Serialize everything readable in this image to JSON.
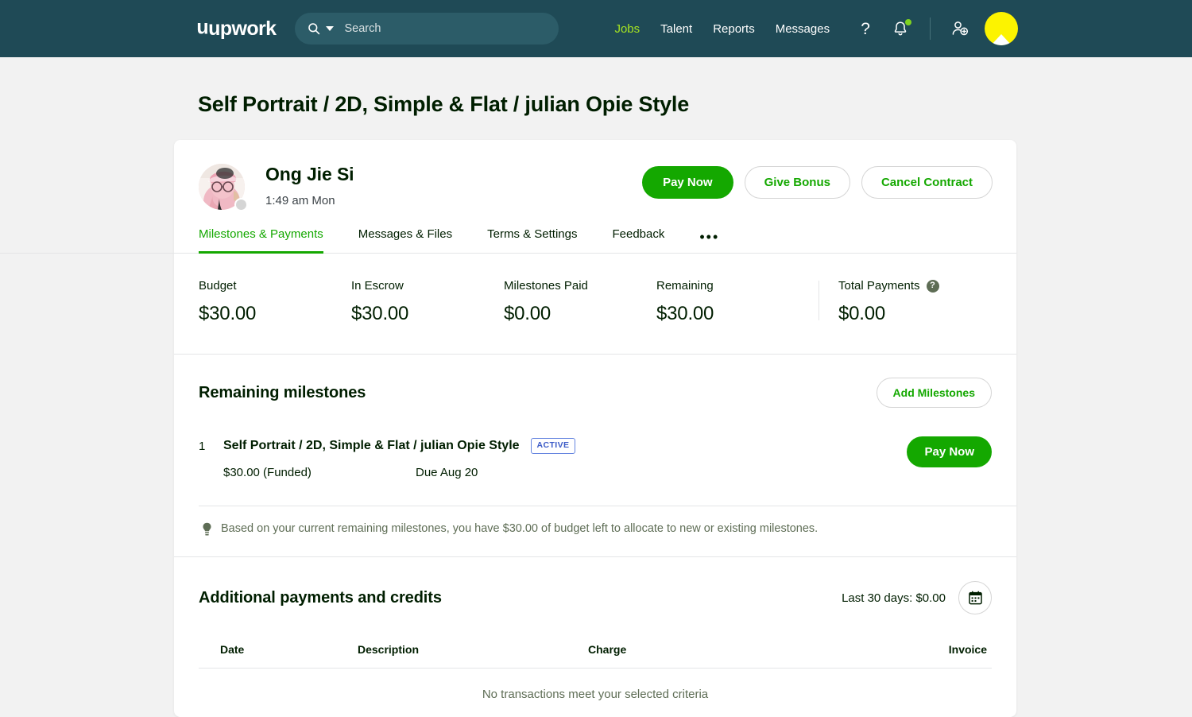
{
  "topnav": {
    "logo": "upwork",
    "search_placeholder": "Search",
    "search_value": "",
    "links": [
      {
        "label": "Jobs",
        "active": true
      },
      {
        "label": "Talent",
        "active": false
      },
      {
        "label": "Reports",
        "active": false
      },
      {
        "label": "Messages",
        "active": false
      }
    ],
    "help_icon": "question-mark-icon",
    "notifications_icon": "bell-icon",
    "notification_badge": true,
    "invite_icon": "add-person-icon",
    "avatar": "user-avatar",
    "bg_color": "#1f4a56",
    "accent_link_color": "#a7e521"
  },
  "page": {
    "title": "Self Portrait / 2D, Simple & Flat / julian Opie Style"
  },
  "contract": {
    "freelancer_name": "Ong Jie Si",
    "local_time": "1:49 am Mon",
    "status": "offline",
    "actions": [
      {
        "label": "Pay Now",
        "style": "primary"
      },
      {
        "label": "Give Bonus",
        "style": "outline"
      },
      {
        "label": "Cancel Contract",
        "style": "outline"
      }
    ]
  },
  "tabs": [
    {
      "label": "Milestones & Payments",
      "active": true
    },
    {
      "label": "Messages & Files",
      "active": false
    },
    {
      "label": "Terms & Settings",
      "active": false
    },
    {
      "label": "Feedback",
      "active": false
    }
  ],
  "tabs_more": "•••",
  "stats": [
    {
      "label": "Budget",
      "value": "$30.00"
    },
    {
      "label": "In Escrow",
      "value": "$30.00"
    },
    {
      "label": "Milestones Paid",
      "value": "$0.00"
    },
    {
      "label": "Remaining",
      "value": "$30.00"
    },
    {
      "label": "Total Payments",
      "value": "$0.00",
      "help": "?"
    }
  ],
  "milestones_section": {
    "title": "Remaining milestones",
    "add_button": "Add Milestones",
    "rows": [
      {
        "index": "1",
        "title": "Self Portrait / 2D, Simple & Flat / julian Opie Style",
        "badge": "ACTIVE",
        "amount": "$30.00 (Funded)",
        "due": "Due Aug 20",
        "action": "Pay Now"
      }
    ],
    "tip": "Based on your current remaining milestones, you have $30.00 of budget left to allocate to new or existing milestones."
  },
  "payments_section": {
    "title": "Additional payments and credits",
    "last_30_days": "Last 30 days: $0.00",
    "calendar_icon": "calendar-icon",
    "columns": [
      "Date",
      "Description",
      "Charge",
      "Invoice"
    ],
    "empty_message": "No transactions meet your selected criteria"
  },
  "colors": {
    "green": "#14a800",
    "nav_bg": "#1f4a56",
    "page_bg": "#f2f2f2",
    "badge_blue": "#3c5bc7"
  }
}
